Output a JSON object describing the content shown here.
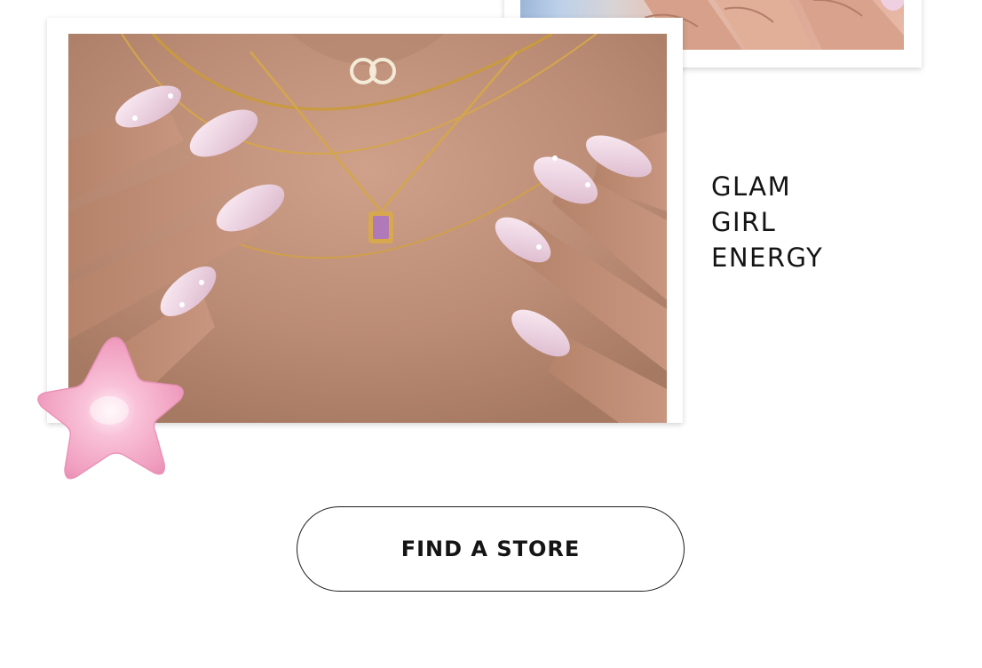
{
  "heading": {
    "lines": [
      "GLAM",
      "GIRL",
      "ENERGY"
    ]
  },
  "cta": {
    "label": "FIND A STORE"
  },
  "images": {
    "top_right": "hands-with-pink-nails-photo",
    "main": "hands-with-pearl-pink-nails-and-gold-necklaces-photo"
  },
  "decoration": {
    "icon": "pink-star-icon",
    "color": "#f4a6c4"
  },
  "colors": {
    "background": "#ffffff",
    "text": "#141414",
    "button_border": "#1e1e1e",
    "nail_pink": "#efd0e0",
    "gold": "#d4a64c",
    "gem": "#b07ab8"
  }
}
